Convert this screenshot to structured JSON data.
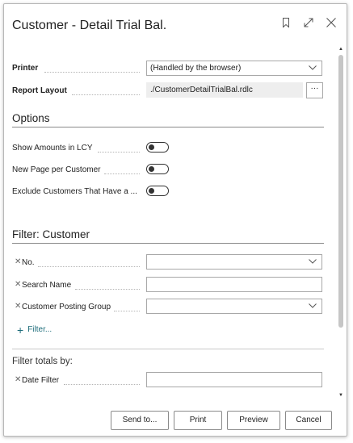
{
  "dialog": {
    "title": "Customer - Detail Trial Bal."
  },
  "printer": {
    "label": "Printer",
    "value": "(Handled by the browser)"
  },
  "report_layout": {
    "label": "Report Layout",
    "value": "./CustomerDetailTrialBal.rdlc",
    "more_label": "···"
  },
  "options": {
    "heading": "Options",
    "items": [
      {
        "label": "Show Amounts in LCY",
        "on": false
      },
      {
        "label": "New Page per Customer",
        "on": false
      },
      {
        "label": "Exclude Customers That Have a ...",
        "on": false
      }
    ]
  },
  "filter_customer": {
    "heading": "Filter: Customer",
    "fields": [
      {
        "label": "No.",
        "value": ""
      },
      {
        "label": "Search Name",
        "value": ""
      },
      {
        "label": "Customer Posting Group",
        "value": ""
      }
    ],
    "add_filter_label": "Filter..."
  },
  "filter_totals": {
    "heading": "Filter totals by:",
    "fields": [
      {
        "label": "Date Filter",
        "value": ""
      }
    ]
  },
  "buttons": {
    "send_to": "Send to...",
    "print": "Print",
    "preview": "Preview",
    "cancel": "Cancel"
  },
  "colors": {
    "accent": "#1d6c7a",
    "border": "#a8a8a8",
    "readonly_bg": "#eeeeee"
  }
}
